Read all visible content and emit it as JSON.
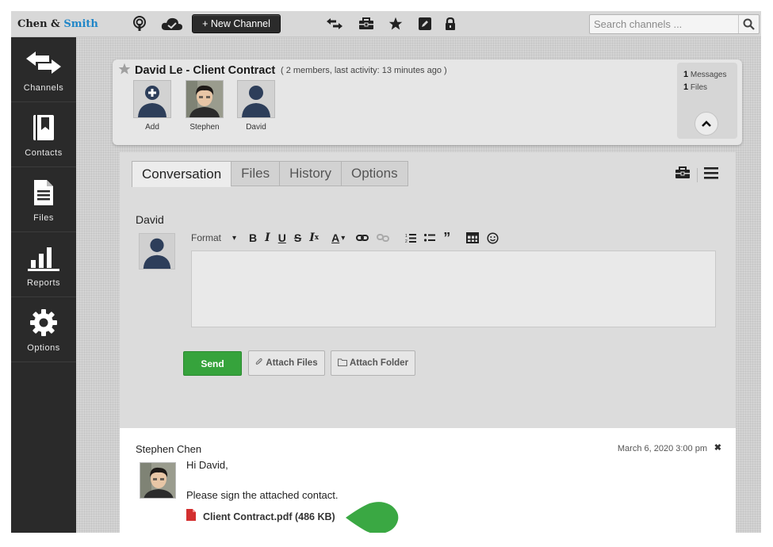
{
  "app": {
    "brand_part1": "Chen & ",
    "brand_part2": "Smith",
    "brand_accent": "#1f86c8"
  },
  "topbar": {
    "icons": [
      "podcast-icon",
      "cloud-check-icon",
      "swap-arrows-icon",
      "briefcase-icon",
      "star-icon",
      "edit-icon",
      "lock-icon"
    ],
    "new_channel_label": "+ New Channel",
    "search_placeholder": "Search channels ..."
  },
  "sidebar": {
    "items": [
      {
        "label": "Channels",
        "icon": "swap-arrows-icon"
      },
      {
        "label": "Contacts",
        "icon": "bookmark-book-icon"
      },
      {
        "label": "Files",
        "icon": "file-icon"
      },
      {
        "label": "Reports",
        "icon": "bar-chart-icon"
      },
      {
        "label": "Options",
        "icon": "gear-icon"
      }
    ]
  },
  "channel": {
    "title": "David Le - Client Contract",
    "meta": "( 2 members, last activity: 13 minutes ago )",
    "members": [
      {
        "name": "Add"
      },
      {
        "name": "Stephen"
      },
      {
        "name": "David"
      }
    ],
    "stats": {
      "messages_count": "1",
      "messages_label": "Messages",
      "files_count": "1",
      "files_label": "Files"
    }
  },
  "tabs": [
    {
      "label": "Conversation",
      "active": true
    },
    {
      "label": "Files",
      "active": false
    },
    {
      "label": "History",
      "active": false
    },
    {
      "label": "Options",
      "active": false
    }
  ],
  "composer": {
    "author": "David",
    "format_label": "Format",
    "toolbar_icons": [
      "bold-icon",
      "italic-icon",
      "underline-icon",
      "strikethrough-icon",
      "clear-format-icon",
      "text-color-icon",
      "link-icon",
      "unlink-icon",
      "numbered-list-icon",
      "bullet-list-icon",
      "blockquote-icon",
      "table-icon",
      "emoji-icon"
    ],
    "editor_value": "",
    "send_label": "Send",
    "attach_files_label": "Attach Files",
    "attach_folder_label": "Attach Folder"
  },
  "message": {
    "author": "Stephen Chen",
    "date": "March 6, 2020 3:00 pm",
    "close": "✖",
    "lines": [
      "Hi David,",
      "Please sign the attached contact."
    ],
    "attachment": "Client Contract.pdf (486 KB)"
  },
  "colors": {
    "send": "#36a33c",
    "pointer": "#3aa843",
    "pdf": "#d32f2f"
  }
}
